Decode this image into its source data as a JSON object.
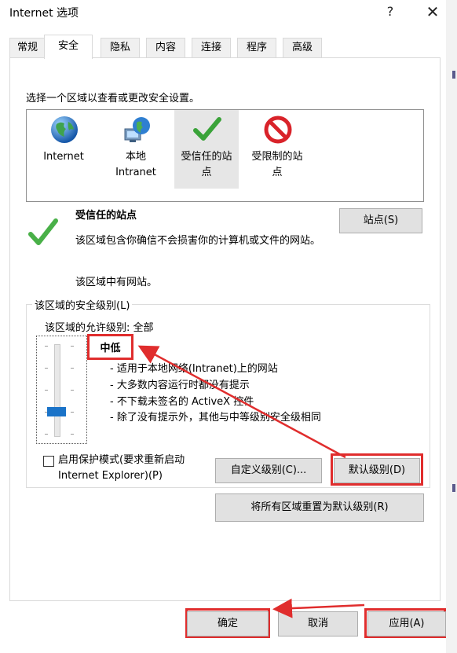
{
  "window": {
    "title": "Internet 选项",
    "help_label": "?",
    "close_label": "✕"
  },
  "tabs": [
    {
      "label": "常规"
    },
    {
      "label": "安全"
    },
    {
      "label": "隐私"
    },
    {
      "label": "内容"
    },
    {
      "label": "连接"
    },
    {
      "label": "程序"
    },
    {
      "label": "高级"
    }
  ],
  "active_tab": "安全",
  "zone_prompt": "选择一个区域以查看或更改安全设置。",
  "zones": [
    {
      "label": "Internet",
      "icon": "globe-icon"
    },
    {
      "label": "本地\nIntranet",
      "icon": "intranet-globe-icon"
    },
    {
      "label": "受信任的站\n点",
      "icon": "trusted-check-icon"
    },
    {
      "label": "受限制的站\n点",
      "icon": "restricted-no-icon"
    }
  ],
  "selected_zone": {
    "name": "受信任的站点",
    "description": "该区域包含你确信不会损害你的计算机或文件的网站。",
    "has_sites": "该区域中有网站。",
    "sites_button": "站点(S)"
  },
  "security_level": {
    "group_title": "该区域的安全级别(L)",
    "allowed_label": "该区域的允许级别: 全部",
    "level_name": "中低",
    "level_fraction": 0.25,
    "bullets": [
      "- 适用于本地网络(Intranet)上的网站",
      "- 大多数内容运行时都没有提示",
      "- 不下载未签名的 ActiveX 控件",
      "- 除了没有提示外，其他与中等级别安全级相同"
    ]
  },
  "protected_mode": {
    "label": "启用保护模式(要求重新启动 Internet Explorer)(P)",
    "checked": false
  },
  "buttons": {
    "custom_level": "自定义级别(C)...",
    "default_level": "默认级别(D)",
    "reset_all": "将所有区域重置为默认级别(R)",
    "ok": "确定",
    "cancel": "取消",
    "apply": "应用(A)"
  },
  "colors": {
    "highlight": "#e02d2d",
    "slider_thumb": "#1a73c8"
  }
}
